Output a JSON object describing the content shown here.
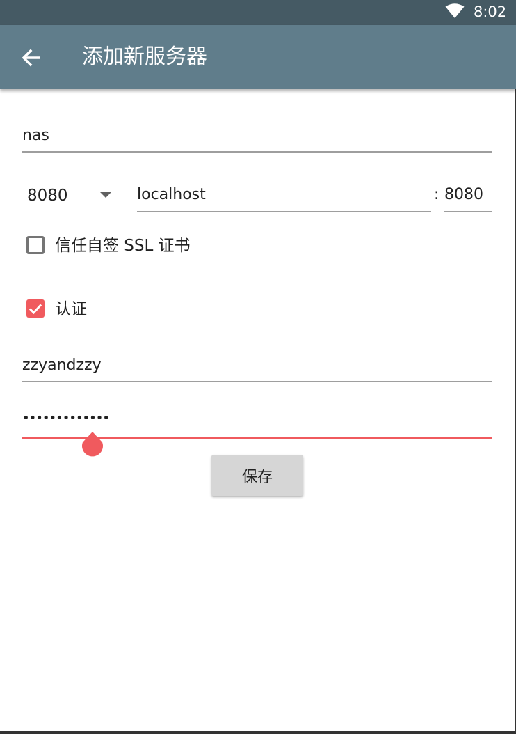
{
  "status_bar": {
    "time": "8:02",
    "wifi_icon": "wifi-icon"
  },
  "app_bar": {
    "title": "添加新服务器",
    "back_icon": "arrow-back-icon"
  },
  "form": {
    "name_value": "nas",
    "port_dropdown_value": "8080",
    "host_value": "localhost",
    "port_separator": ":",
    "port_value": "8080",
    "trust_ssl": {
      "label": "信任自签 SSL 证书",
      "checked": false
    },
    "auth": {
      "label": "认证",
      "checked": true
    },
    "username_value": "zzyandzzy",
    "password_value": "•••••••••••••",
    "save_label": "保存"
  },
  "colors": {
    "status_bar": "#455a64",
    "app_bar": "#607d8b",
    "accent": "#f05a5e"
  }
}
